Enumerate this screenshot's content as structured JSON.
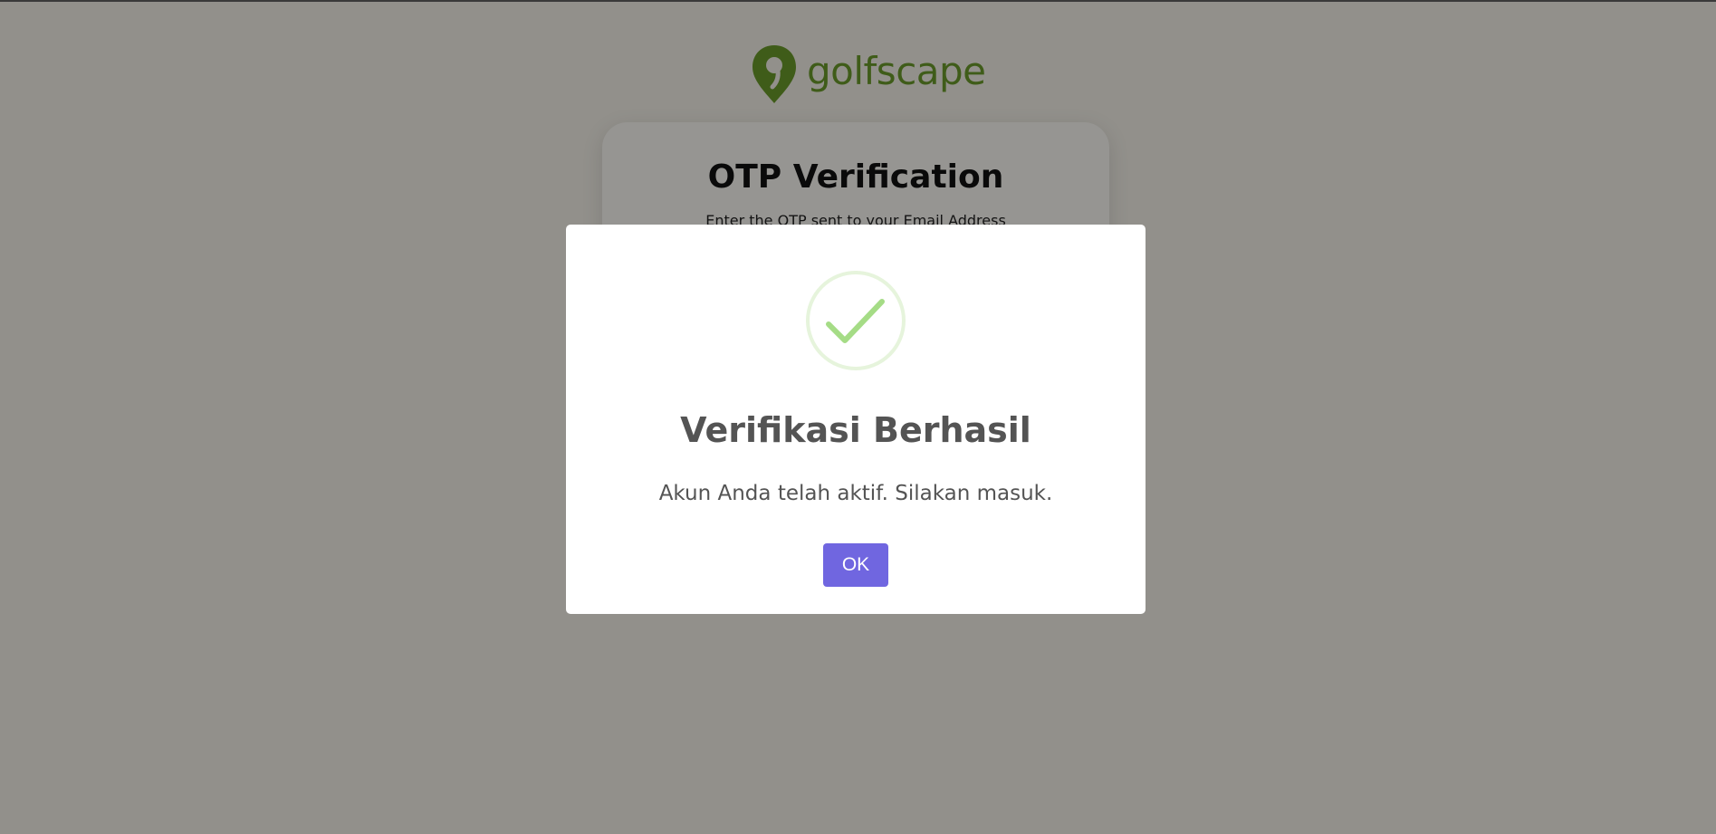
{
  "logo": {
    "text": "golfscape",
    "icon": "location-pin-golf-icon",
    "color": "#6a9a2a"
  },
  "otp_card": {
    "title": "OTP Verification",
    "subtitle": "Enter the OTP sent to your Email Address"
  },
  "modal": {
    "icon": "success-check-icon",
    "title": "Verifikasi Berhasil",
    "text": "Akun Anda telah aktif. Silakan masuk.",
    "confirm_label": "OK",
    "confirm_color": "#7066e0",
    "success_color": "#a5dc86"
  }
}
